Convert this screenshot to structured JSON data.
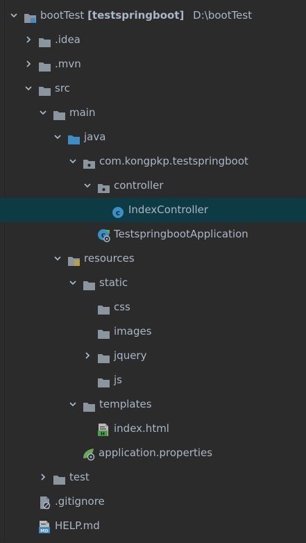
{
  "project_tree": {
    "root": {
      "name": "bootTest",
      "module": "[testspringboot]",
      "path": "D:\\bootTest"
    },
    "items": [
      {
        "label": ".idea"
      },
      {
        "label": ".mvn"
      },
      {
        "label": "src"
      },
      {
        "label": "main"
      },
      {
        "label": "java"
      },
      {
        "label": "com.kongpkp.testspringboot"
      },
      {
        "label": "controller"
      },
      {
        "label": "IndexController"
      },
      {
        "label": "TestspringbootApplication"
      },
      {
        "label": "resources"
      },
      {
        "label": "static"
      },
      {
        "label": "css"
      },
      {
        "label": "images"
      },
      {
        "label": "jquery"
      },
      {
        "label": "js"
      },
      {
        "label": "templates"
      },
      {
        "label": "index.html"
      },
      {
        "label": "application.properties"
      },
      {
        "label": "test"
      },
      {
        "label": ".gitignore"
      },
      {
        "label": "HELP.md"
      }
    ]
  },
  "colors": {
    "background": "#2b2b2b",
    "selection": "#0d3a43",
    "folder": "#8a959e",
    "source_folder": "#3f8cc4",
    "resources_folder_bars": "#c9a227",
    "class_icon": "#3a8fc4",
    "spring_green": "#6aa75a",
    "html_green": "#4e9a4e",
    "text": "#a9b7c6"
  },
  "icons": {
    "module": "module-folder-icon",
    "folder": "folder-icon",
    "source_root": "source-root-folder-icon",
    "package": "package-icon",
    "class": "class-icon",
    "spring_boot_app": "spring-boot-app-icon",
    "resources_root": "resources-root-icon",
    "html_file": "html-file-icon",
    "properties_file": "spring-properties-icon",
    "gitignore": "gitignore-icon",
    "markdown": "markdown-icon",
    "chevron_down": "chevron-down-icon",
    "chevron_right": "chevron-right-icon"
  }
}
